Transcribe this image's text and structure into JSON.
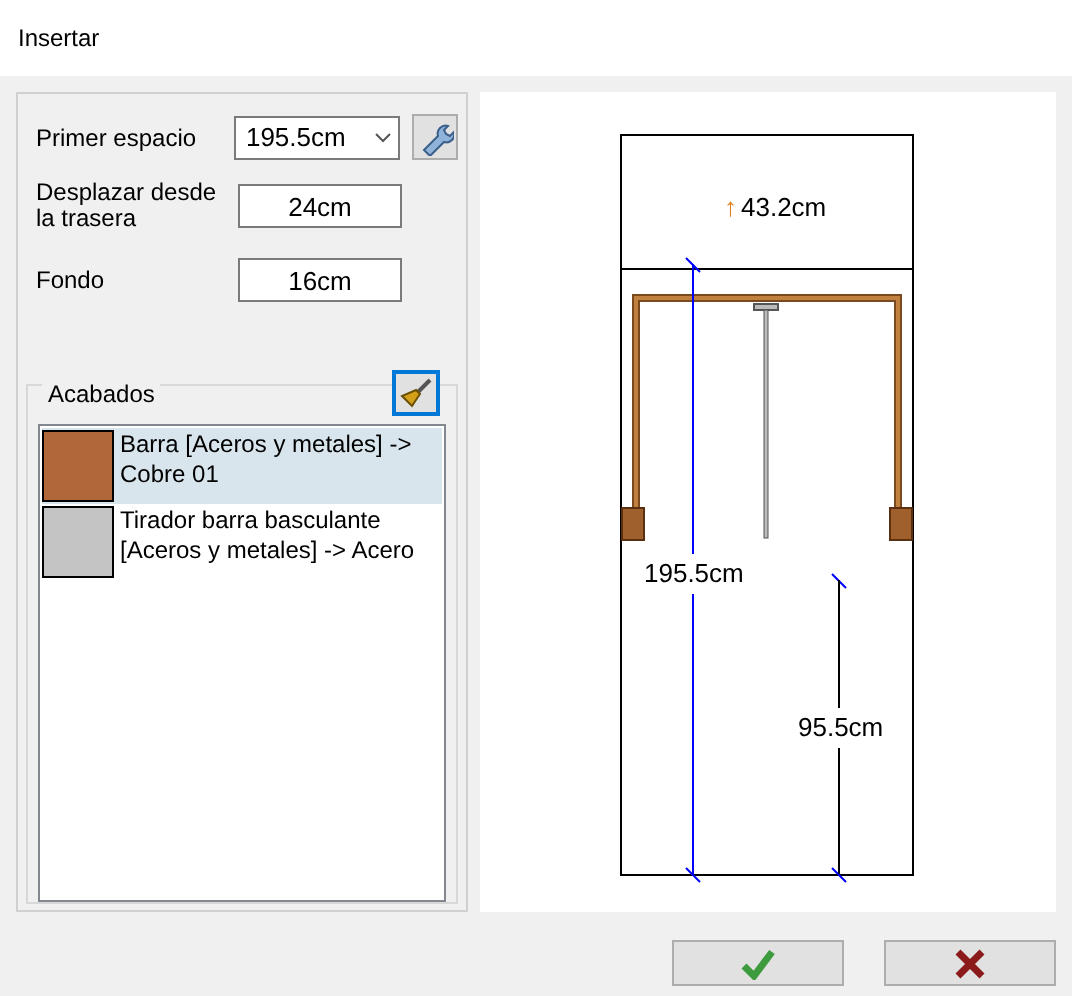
{
  "window": {
    "title": "Insertar"
  },
  "form": {
    "primer_espacio": {
      "label": "Primer espacio",
      "value": "195.5cm"
    },
    "desplazar": {
      "label": "Desplazar desde la trasera",
      "value": "24cm"
    },
    "fondo": {
      "label": "Fondo",
      "value": "16cm"
    }
  },
  "acabados": {
    "title": "Acabados",
    "items": [
      {
        "name": "Barra [Aceros y metales] -> Cobre 01",
        "color": "#b0683a",
        "selected": true
      },
      {
        "name": "Tirador barra basculante [Aceros y metales] -> Acero",
        "color": "#c4c4c4",
        "selected": false
      }
    ]
  },
  "drawing": {
    "top_label": "43.2cm",
    "top_arrow": "↑",
    "height_label": "195.5cm",
    "bar_height_label": "95.5cm"
  }
}
